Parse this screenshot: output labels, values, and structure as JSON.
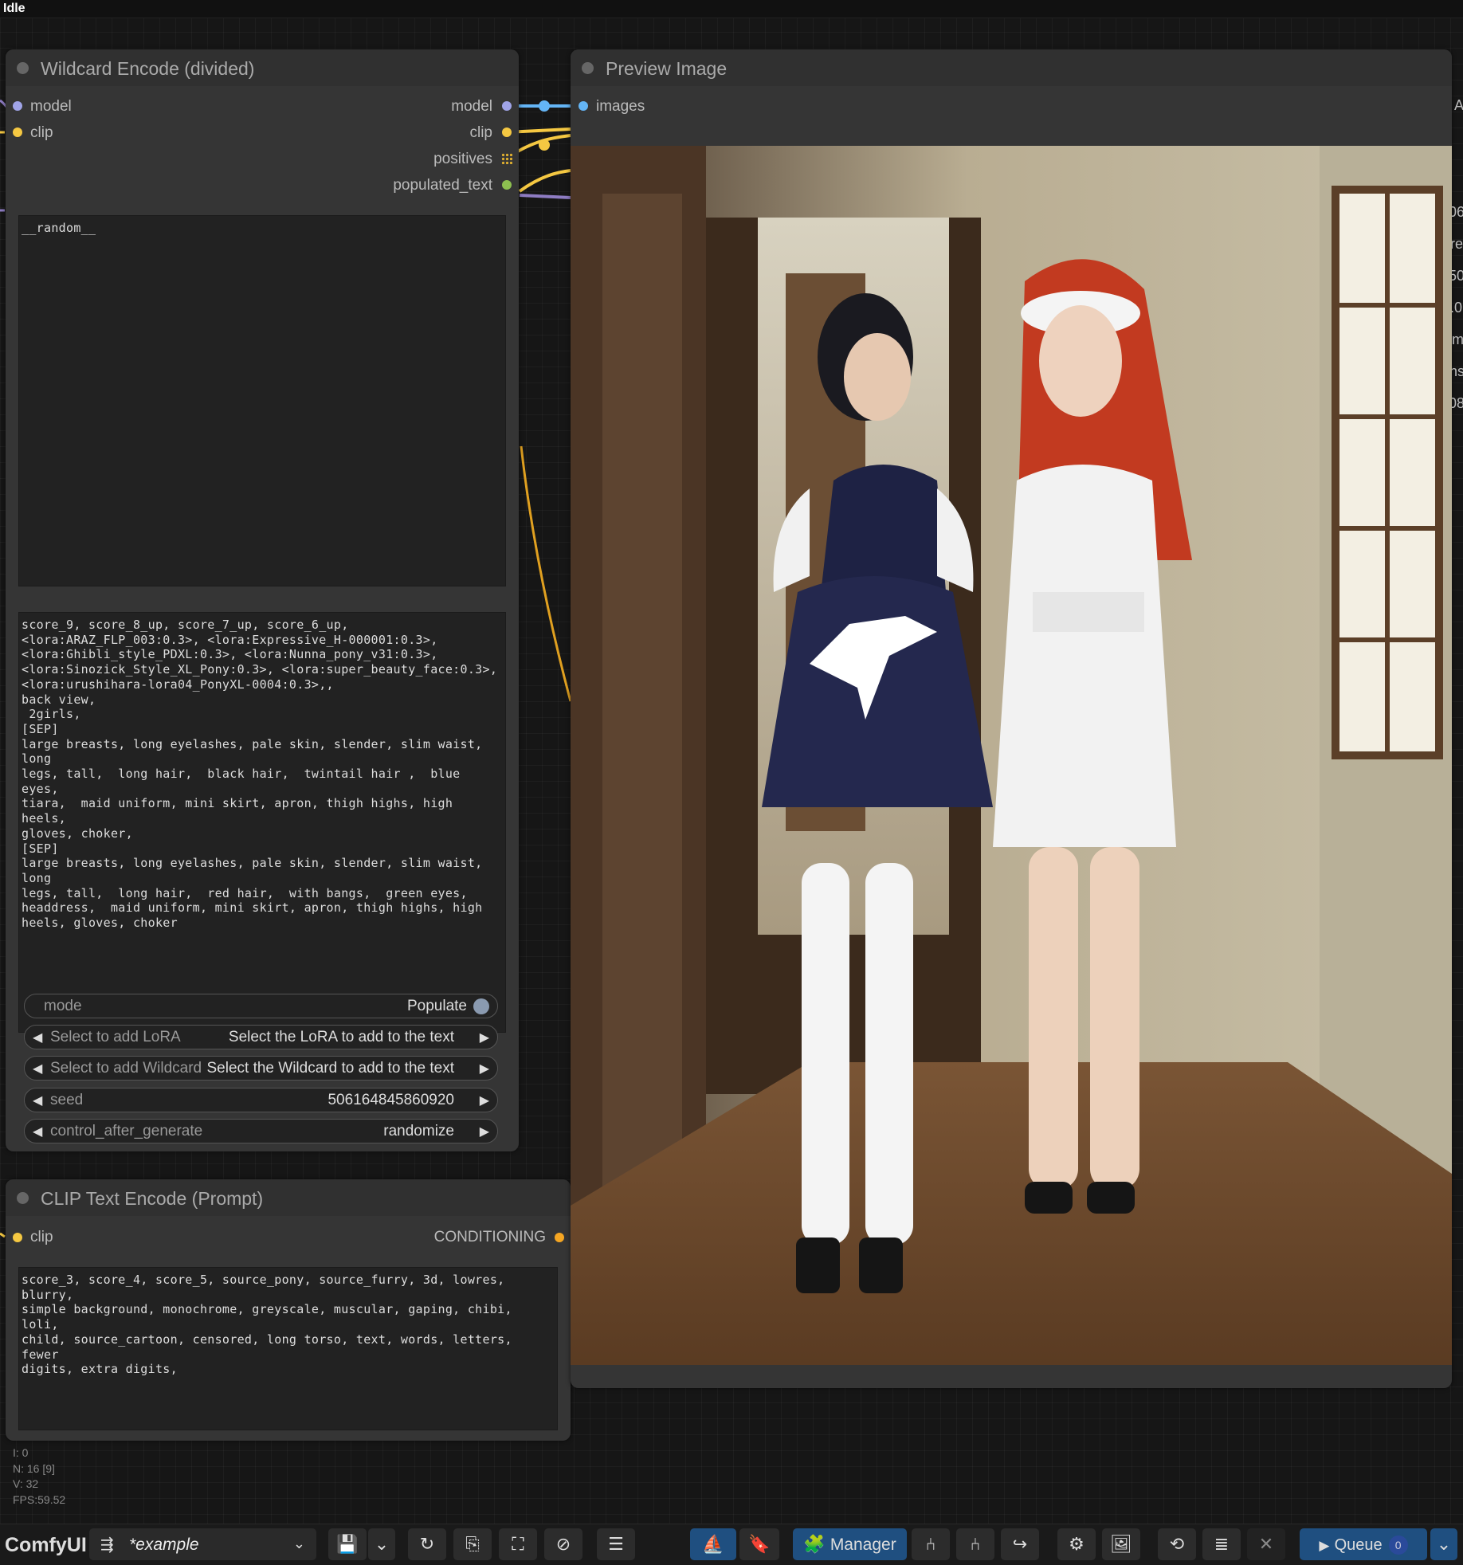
{
  "status": "Idle",
  "wildcard_node": {
    "title": "Wildcard Encode (divided)",
    "inputs": [
      "model",
      "clip"
    ],
    "outputs": [
      "model",
      "clip",
      "positives",
      "populated_text"
    ],
    "wildcard_text": "__random__",
    "populated_text": "score_9, score_8_up, score_7_up, score_6_up,\n<lora:ARAZ_FLP_003:0.3>, <lora:Expressive_H-000001:0.3>,\n<lora:Ghibli_style_PDXL:0.3>, <lora:Nunna_pony_v31:0.3>,\n<lora:Sinozick_Style_XL_Pony:0.3>, <lora:super_beauty_face:0.3>,\n<lora:urushihara-lora04_PonyXL-0004:0.3>,,\nback view,\n 2girls,\n[SEP]\nlarge breasts, long eyelashes, pale skin, slender, slim waist, long\nlegs, tall,  long hair,  black hair,  twintail hair ,  blue eyes,\ntiara,  maid uniform, mini skirt, apron, thigh highs, high heels,\ngloves, choker,\n[SEP]\nlarge breasts, long eyelashes, pale skin, slender, slim waist, long\nlegs, tall,  long hair,  red hair,  with bangs,  green eyes,\nheaddress,  maid uniform, mini skirt, apron, thigh highs, high\nheels, gloves, choker",
    "mode_label": "mode",
    "mode_value": "Populate",
    "lora_label": "Select to add LoRA",
    "lora_value": "Select the LoRA to add to the text",
    "wildcard_label": "Select to add Wildcard",
    "wildcard_value": "Select the Wildcard to add to the text",
    "seed_label": "seed",
    "seed_value": "506164845860920",
    "control_label": "control_after_generate",
    "control_value": "randomize"
  },
  "preview_node": {
    "title": "Preview Image",
    "input": "images"
  },
  "clip_node": {
    "title": "CLIP Text Encode (Prompt)",
    "input": "clip",
    "output": "CONDITIONING",
    "text": "score_3, score_4, score_5, source_pony, source_furry, 3d, lowres, blurry,\nsimple background, monochrome, greyscale, muscular, gaping, chibi, loli,\nchild, source_cartoon, censored, long torso, text, words, letters, fewer\ndigits, extra digits,"
  },
  "right_edge_fragments": [
    "A",
    "06",
    "re",
    "50",
    ".0",
    "m",
    "ns",
    "08"
  ],
  "stats": [
    "I: 0",
    "N: 16 [9]",
    "V: 32",
    "FPS:59.52"
  ],
  "bottombar": {
    "logo": "ComfyUI",
    "workflow_name": "*example",
    "manager_label": "Manager",
    "queue_label": "Queue",
    "queue_count": "0"
  },
  "colors": {
    "model": "#a0a4e8",
    "clip": "#f5c842",
    "text": "#8dc050",
    "images": "#64b5f6",
    "conditioning": "#f5a623"
  }
}
